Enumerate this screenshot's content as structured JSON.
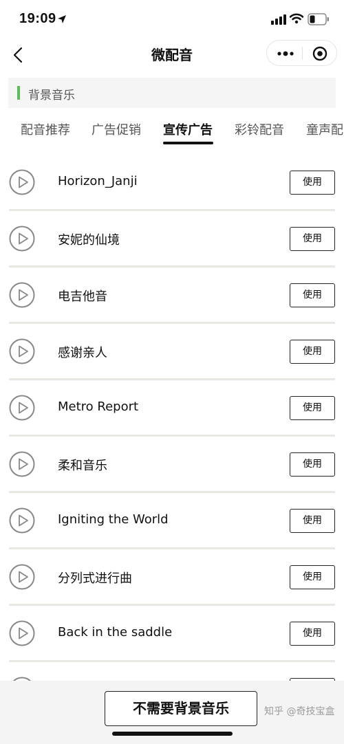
{
  "status_bar": {
    "time": "19:09"
  },
  "nav": {
    "title": "微配音"
  },
  "section": {
    "title": "背景音乐"
  },
  "tabs": [
    {
      "label": "配音推荐",
      "active": false
    },
    {
      "label": "广告促销",
      "active": false
    },
    {
      "label": "宣传广告",
      "active": true
    },
    {
      "label": "彩铃配音",
      "active": false
    },
    {
      "label": "童声配",
      "active": false
    }
  ],
  "tracks": [
    {
      "name": "Horizon_Janji",
      "action": "使用"
    },
    {
      "name": "安妮的仙境",
      "action": "使用"
    },
    {
      "name": "电吉他音",
      "action": "使用"
    },
    {
      "name": "感谢亲人",
      "action": "使用"
    },
    {
      "name": "Metro Report",
      "action": "使用"
    },
    {
      "name": "柔和音乐",
      "action": "使用"
    },
    {
      "name": "Igniting the World",
      "action": "使用"
    },
    {
      "name": "分列式进行曲",
      "action": "使用"
    },
    {
      "name": "Back in the saddle",
      "action": "使用"
    }
  ],
  "bottom": {
    "button_label": "不需要背景音乐"
  },
  "watermark": "知乎 @奇技宝盒",
  "colors": {
    "accent": "#5dbb5a",
    "separator": "#e9e7e2"
  }
}
